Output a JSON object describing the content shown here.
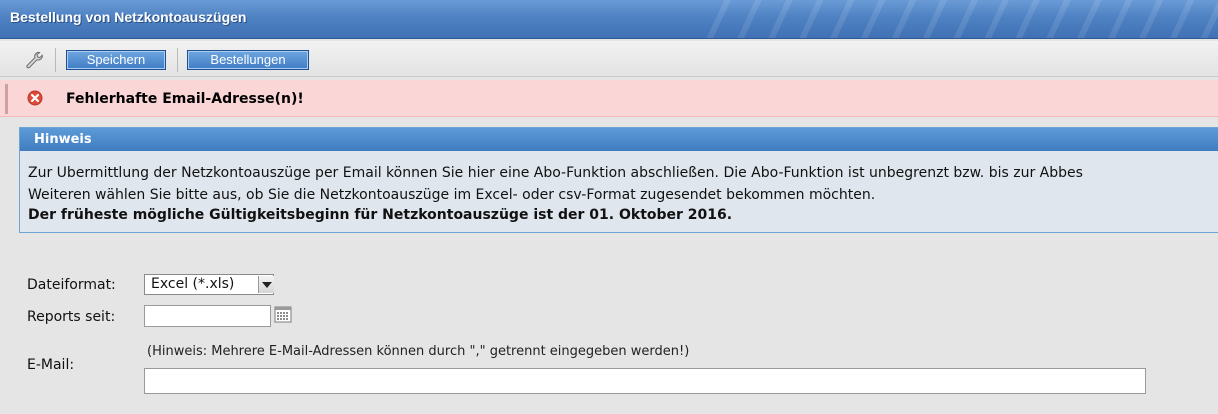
{
  "window": {
    "title": "Bestellung von Netzkontoauszügen"
  },
  "toolbar": {
    "settings_icon": "wrench-icon",
    "save_label": "Speichern",
    "orders_label": "Bestellungen"
  },
  "alert": {
    "icon": "error-x-icon",
    "message": "Fehlerhafte Email-Adresse(n)!",
    "color": "#fbd6d6"
  },
  "hint": {
    "title": "Hinweis",
    "line1": "Zur Übermittlung der Netzkontoauszüge per Email können Sie hier eine Abo-Funktion abschließen. Die Abo-Funktion ist unbegrenzt bzw. bis zur Abbes",
    "line2": "Weiteren wählen Sie bitte aus, ob Sie die Netzkontoauszüge im Excel- oder csv-Format zugesendet bekommen möchten.",
    "line3": "Der früheste mögliche Gültigkeitsbeginn für Netzkontoauszüge ist der 01. Oktober 2016."
  },
  "form": {
    "format_label": "Dateiformat:",
    "format_value": "Excel (*.xls)",
    "reports_label": "Reports seit:",
    "reports_value": "",
    "calendar_icon": "calendar-icon",
    "email_label": "E-Mail:",
    "email_hint": "(Hinweis: Mehrere E-Mail-Adressen können durch \",\" getrennt eingegeben werden!)",
    "email_value": ""
  },
  "colors": {
    "title_bar": "#4f82c3",
    "button": "#3f7cc4",
    "hint_header": "#3f7dc1",
    "hint_body": "#dfe6ee"
  }
}
